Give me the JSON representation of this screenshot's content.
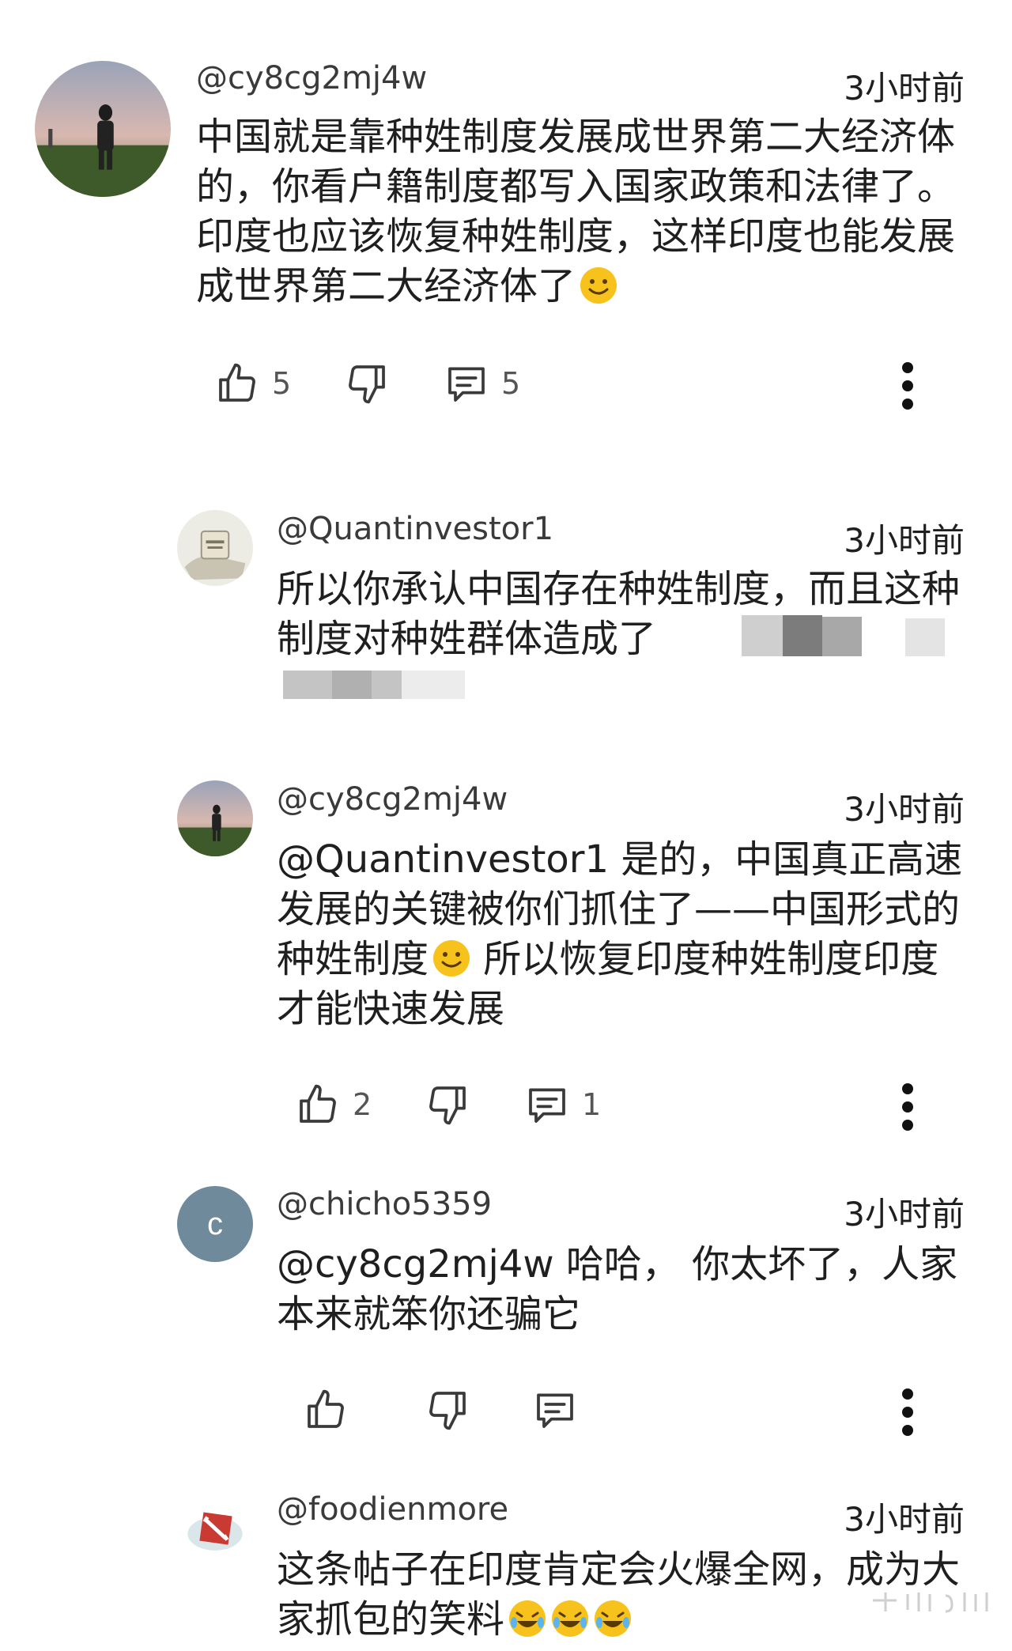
{
  "comments": [
    {
      "handle": "@cy8cg2mj4w",
      "time": "3小时前",
      "text": "中国就是靠种姓制度发展成世界第二大经济体的，你看户籍制度都写入国家政策和法律了。印度也应该恢复种姓制度，这样印度也能发展成世界第二大经济体了",
      "likes": "5",
      "replies": "5",
      "avatar": "person-at-dusk"
    },
    {
      "handle": "@Quantinvestor1",
      "time": "3小时前",
      "text": "所以你承认中国存在种姓制度，而且这种制度对种姓群体造成了",
      "avatar": "hand-holding-bag"
    },
    {
      "handle": "@cy8cg2mj4w",
      "time": "3小时前",
      "text_a": "@Quantinvestor1 是的，中国真正高速发展的关键被你们抓住了——中国形式的种姓制度",
      "text_b": " 所以恢复印度种姓制度印度才能快速发展",
      "likes": "2",
      "replies": "1",
      "avatar": "person-at-dusk"
    },
    {
      "handle": "@chicho5359",
      "time": "3小时前",
      "text": "@cy8cg2mj4w 哈哈，  你太坏了，人家本来就笨你还骗它",
      "avatar_letter": "c",
      "avatar_color": "#6f8a9a"
    },
    {
      "handle": "@foodienmore",
      "time": "3小时前",
      "text": "这条帖子在印度肯定会火爆全网，成为大家抓包的笑料",
      "avatar": "dota-logo"
    }
  ],
  "colors": {
    "like-icon": "#3a3a3a",
    "emoji-yellow": "#f7c21b"
  }
}
